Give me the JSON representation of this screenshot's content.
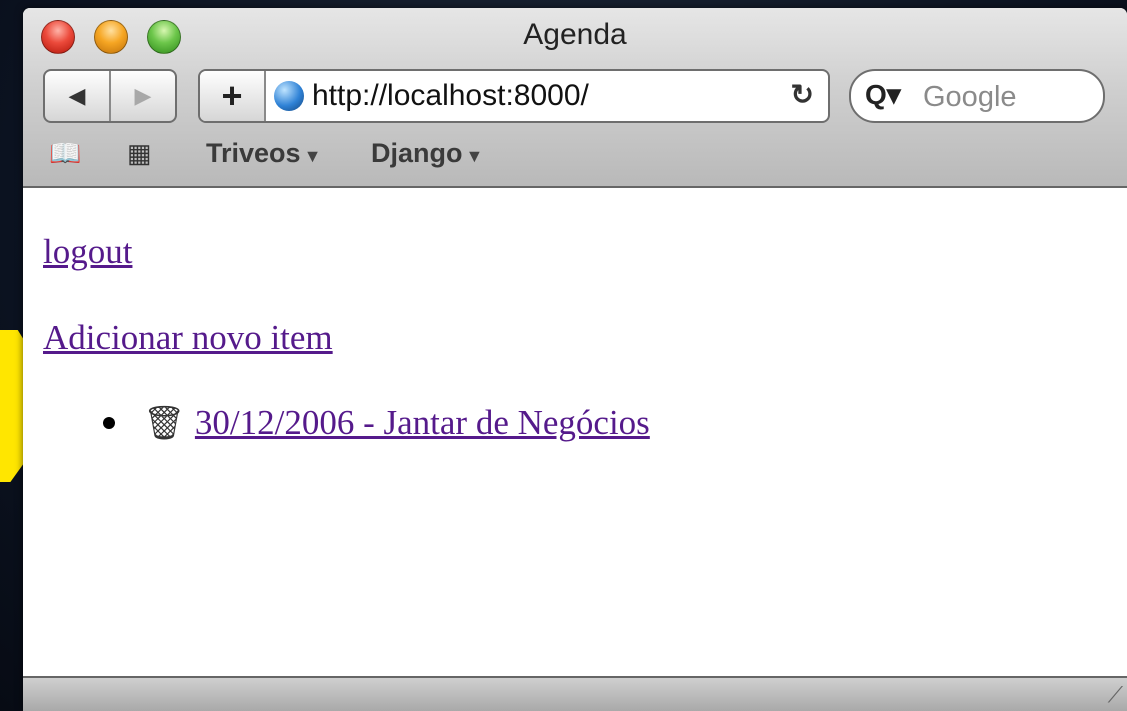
{
  "window": {
    "title": "Agenda"
  },
  "toolbar": {
    "back_icon": "◀",
    "forward_icon": "▶",
    "add_icon": "+",
    "url": "http://localhost:8000/",
    "reload_icon": "↻",
    "search_icon": "🔍",
    "search_placeholder": "Google"
  },
  "bookmarks": {
    "items": [
      {
        "label": "Triveos"
      },
      {
        "label": "Django"
      }
    ]
  },
  "page": {
    "logout_label": "logout",
    "add_label": "Adicionar novo item",
    "items": [
      {
        "label": "30/12/2006 - Jantar de Negócios"
      }
    ]
  },
  "colors": {
    "link": "#551a8b",
    "arrow": "#ffe600"
  }
}
